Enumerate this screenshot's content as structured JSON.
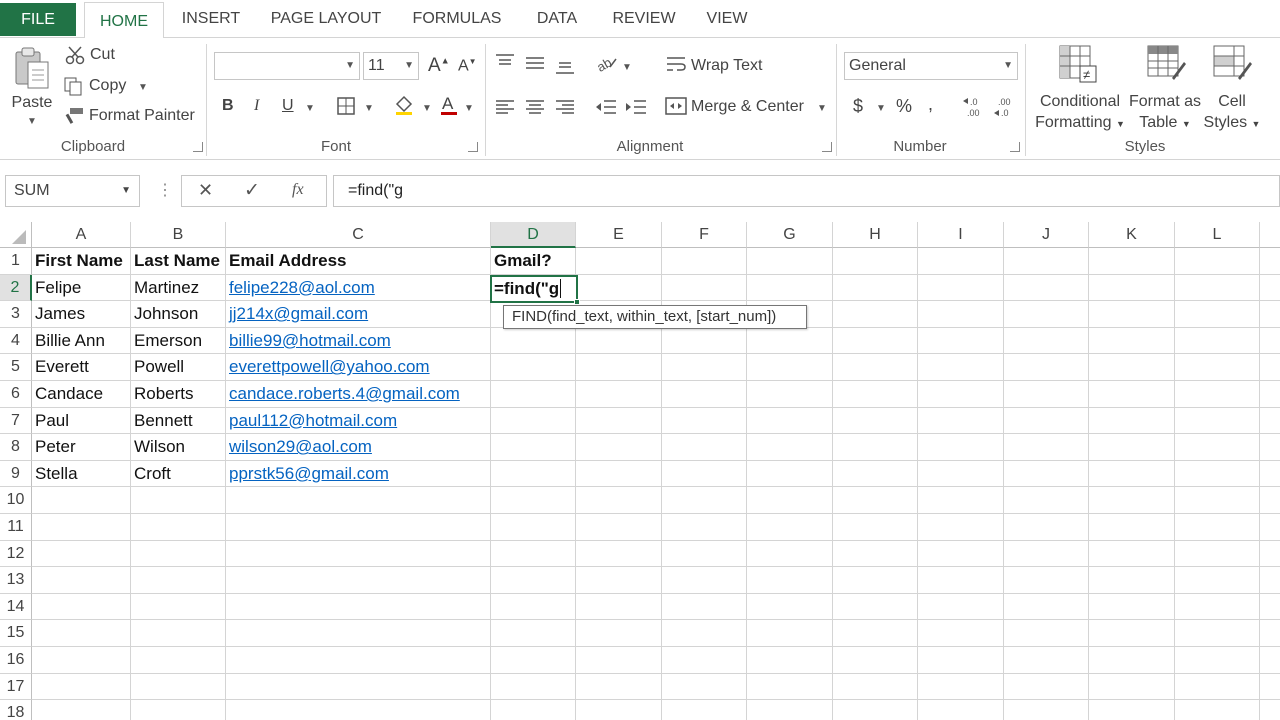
{
  "tabs": [
    "FILE",
    "HOME",
    "INSERT",
    "PAGE LAYOUT",
    "FORMULAS",
    "DATA",
    "REVIEW",
    "VIEW"
  ],
  "colors": {
    "accent": "#217346",
    "link": "#0563c1",
    "selected_header_bg": "#e1e1e1"
  },
  "clipboard": {
    "paste": "Paste",
    "cut": "Cut",
    "copy": "Copy",
    "format_painter": "Format Painter",
    "group_label": "Clipboard"
  },
  "font": {
    "family": "",
    "size": "11",
    "bold": "B",
    "italic": "I",
    "underline": "U",
    "group_label": "Font"
  },
  "alignment": {
    "wrap_text": "Wrap Text",
    "merge_center": "Merge & Center",
    "group_label": "Alignment"
  },
  "number": {
    "format": "General",
    "currency": "$",
    "percent": "%",
    "comma": ",",
    "group_label": "Number"
  },
  "styles": {
    "conditional_1": "Conditional",
    "conditional_2": "Formatting",
    "format_table_1": "Format as",
    "format_table_2": "Table",
    "cell_styles_1": "Cell",
    "cell_styles_2": "Styles",
    "group_label": "Styles"
  },
  "formula_bar": {
    "name_box": "SUM",
    "cancel": "✕",
    "enter": "✓",
    "fx": "fx",
    "formula": "=find(\"g"
  },
  "columns": [
    "A",
    "B",
    "C",
    "D",
    "E",
    "F",
    "G",
    "H",
    "I",
    "J",
    "K",
    "L"
  ],
  "rows": [
    "1",
    "2",
    "3",
    "4",
    "5",
    "6",
    "7",
    "8",
    "9",
    "10",
    "11",
    "12",
    "13",
    "14",
    "15",
    "16",
    "17",
    "18"
  ],
  "sheet": {
    "headers": [
      "First Name",
      "Last Name",
      "Email Address",
      "Gmail?"
    ],
    "data": [
      [
        "Felipe",
        "Martinez",
        "felipe228@aol.com"
      ],
      [
        "James",
        "Johnson",
        "jj214x@gmail.com"
      ],
      [
        "Billie Ann",
        "Emerson",
        "billie99@hotmail.com"
      ],
      [
        "Everett",
        "Powell",
        "everettpowell@yahoo.com"
      ],
      [
        "Candace",
        "Roberts",
        "candace.roberts.4@gmail.com"
      ],
      [
        "Paul",
        "Bennett",
        "paul112@hotmail.com"
      ],
      [
        "Peter",
        "Wilson",
        "wilson29@aol.com"
      ],
      [
        "Stella",
        "Croft",
        "pprstk56@gmail.com"
      ]
    ],
    "active_cell_text": "=find(\"g",
    "tooltip": "FIND(find_text, within_text, [start_num])"
  }
}
